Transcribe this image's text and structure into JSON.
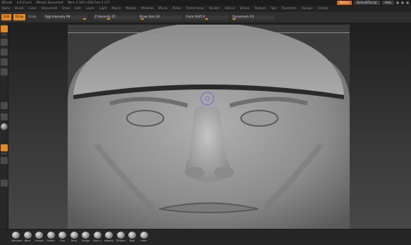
{
  "titlebar": {
    "app": "ZBrush",
    "version": "4.0 [Core]",
    "document": "ZBrush Document",
    "mem": "Mem 4 187+358 Free 3 177",
    "buttons": {
      "menus": "Menus",
      "script": "DefaultZScript",
      "help": "Help"
    }
  },
  "menubar": {
    "items": [
      "Alpha",
      "Brush",
      "Color",
      "Document",
      "Draw",
      "Edit",
      "Layer",
      "Light",
      "Macro",
      "Marker",
      "Material",
      "Movie",
      "Picker",
      "Preferences",
      "Render",
      "Stencil",
      "Stroke",
      "Texture",
      "Tool",
      "Transform",
      "Zplugin",
      "Zscript"
    ]
  },
  "toolbar": {
    "edit_label": "Edit",
    "draw_label": "Draw",
    "scale_label": "Scale",
    "sliders": [
      {
        "label": "Rgb Intensity",
        "value": "99"
      },
      {
        "label": "Z Intensity",
        "value": "25"
      },
      {
        "label": "Draw Size",
        "value": "24"
      },
      {
        "label": "Focal Shift",
        "value": "0"
      },
      {
        "label": "Dynamesh",
        "value": "10"
      }
    ]
  },
  "leftbar": {
    "labels": [
      "Edit",
      "Zsub"
    ]
  },
  "bottombar": {
    "brushes": [
      "Standard",
      "Move",
      "Smooth",
      "Flatten",
      "Clay",
      "Pinch",
      "Nudge",
      "Dam_S",
      "Magnify",
      "ZProject",
      "Blob",
      "Layer"
    ]
  },
  "colors": {
    "accent": "#e58a1c",
    "skin": "#9a9a9a"
  }
}
